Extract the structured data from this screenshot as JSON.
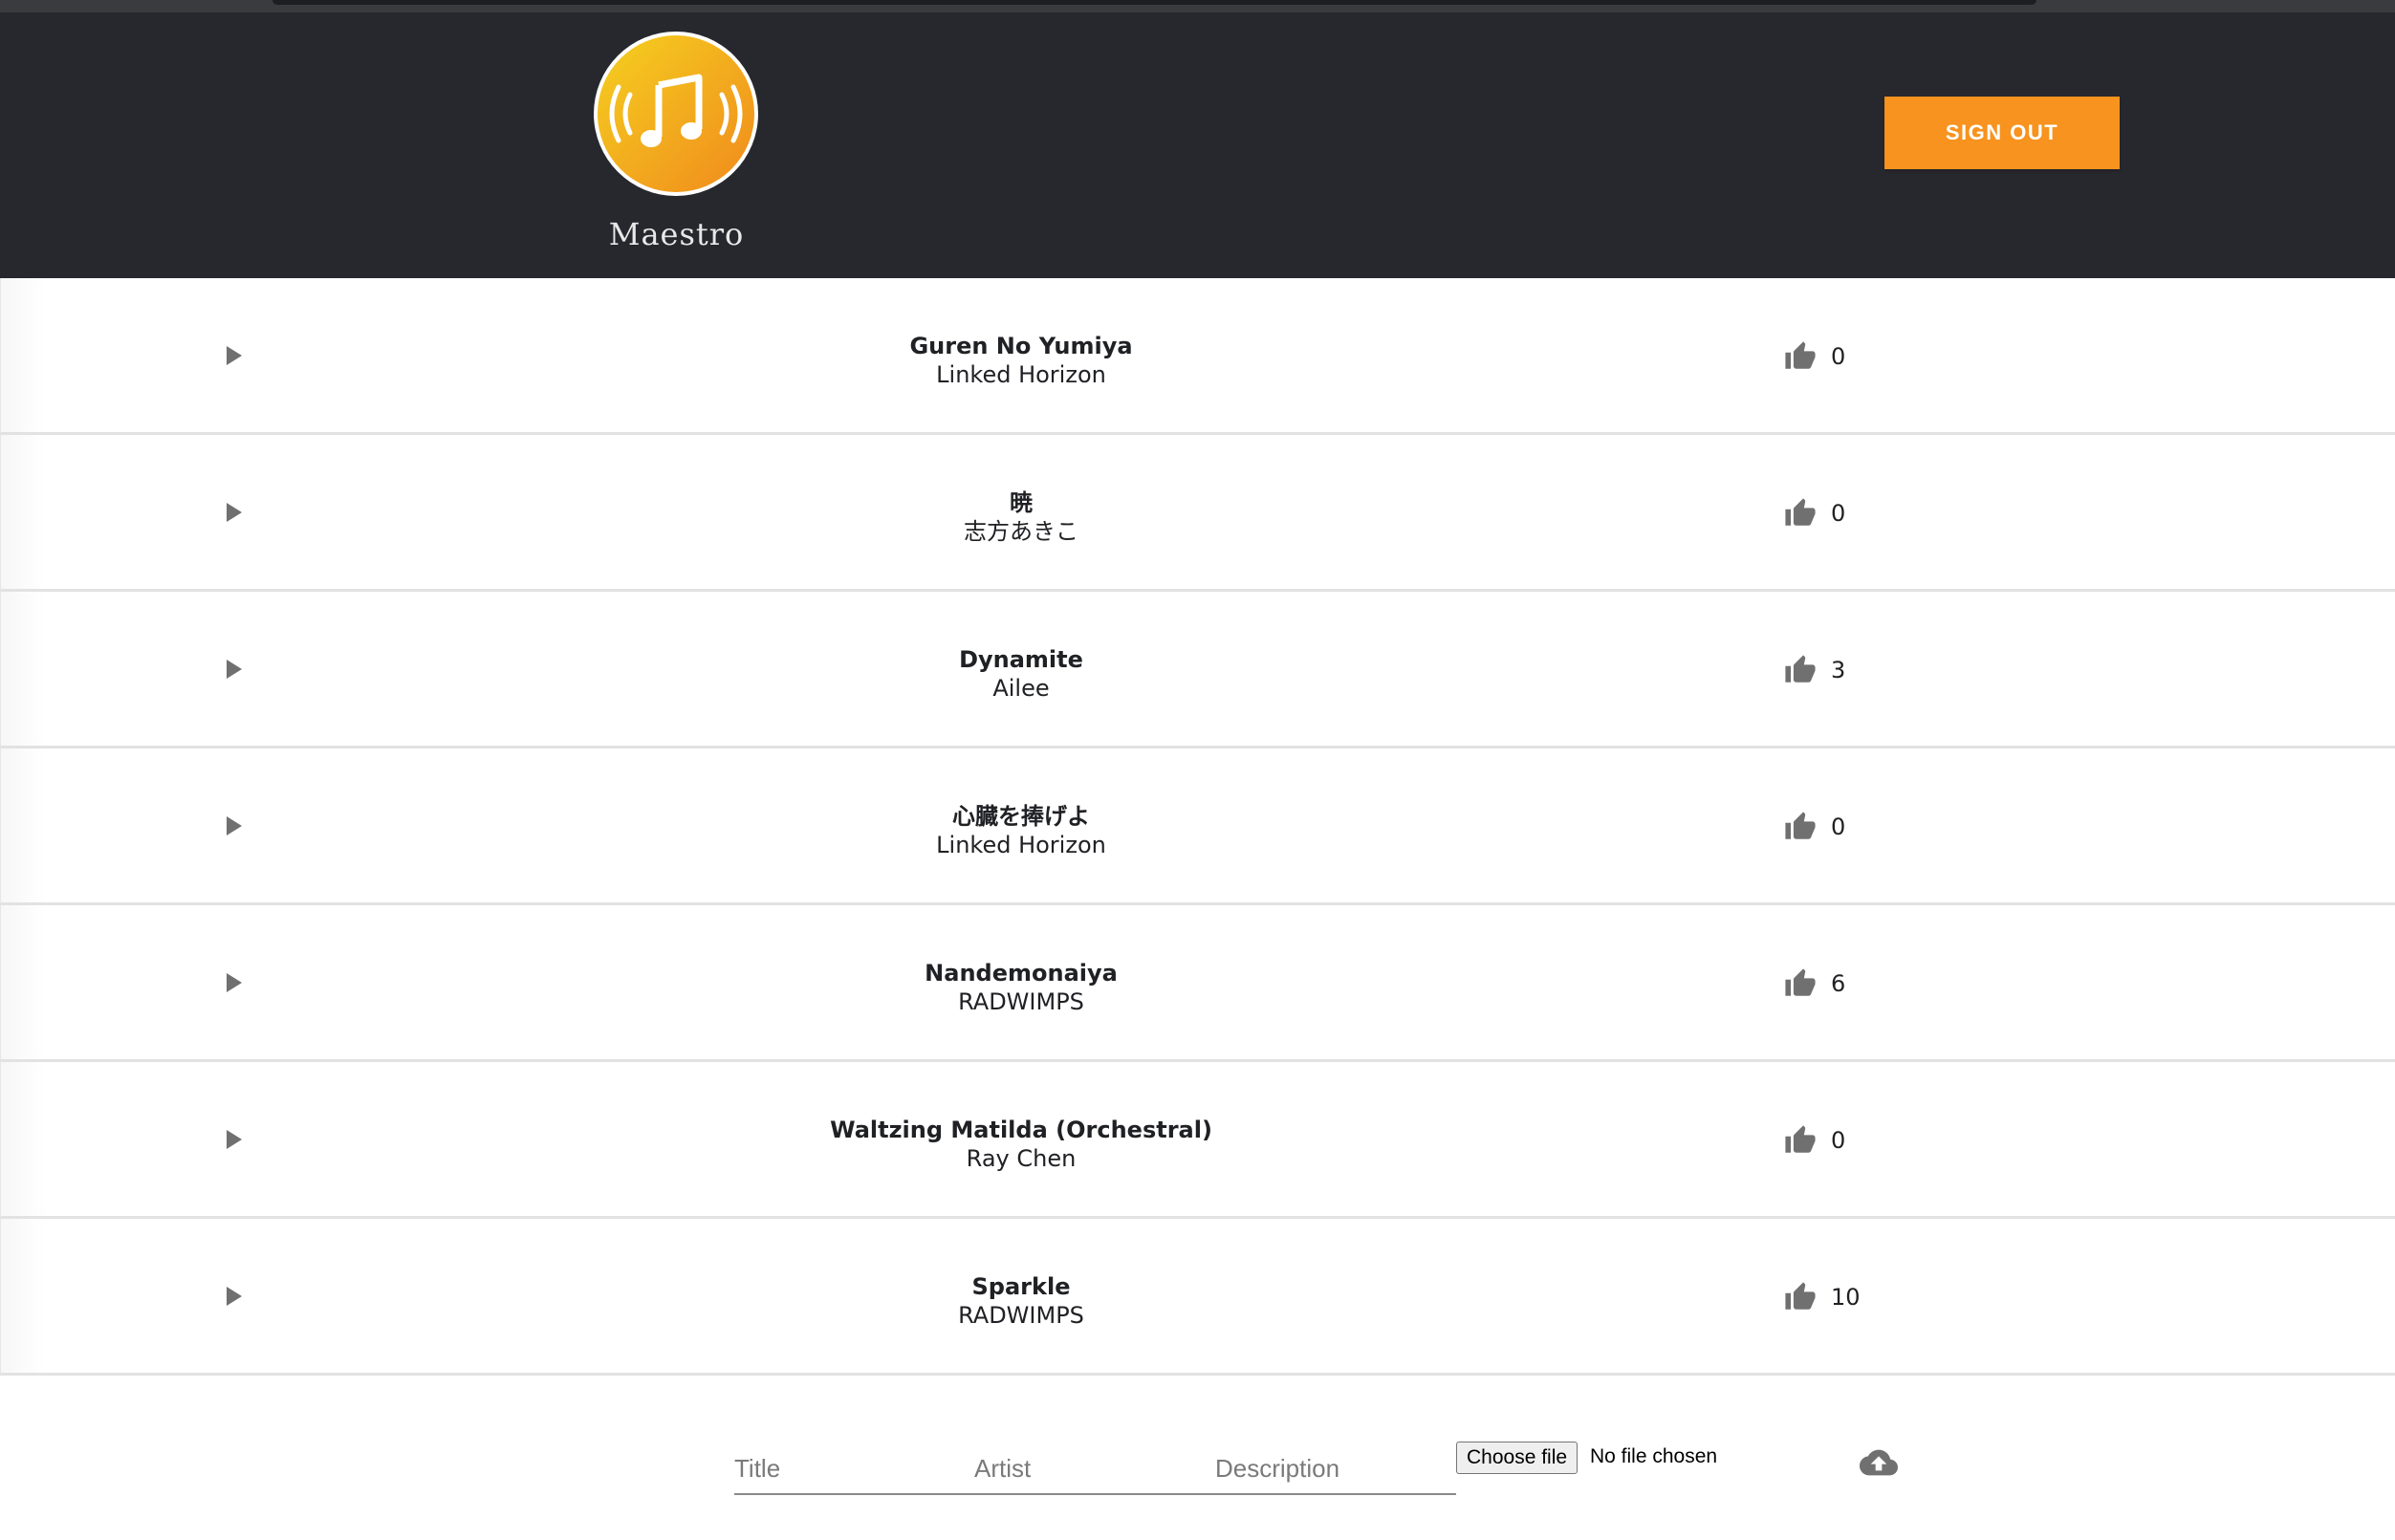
{
  "app": {
    "name": "Maestro"
  },
  "header": {
    "signout_label": "SIGN OUT"
  },
  "colors": {
    "navbar": "#27282d",
    "accent": "#f7931e",
    "icon": "#707070"
  },
  "songs": [
    {
      "title": "Guren No Yumiya",
      "artist": "Linked Horizon",
      "likes": "0"
    },
    {
      "title": "暁",
      "artist": "志方あきこ",
      "likes": "0"
    },
    {
      "title": "Dynamite",
      "artist": "Ailee",
      "likes": "3"
    },
    {
      "title": "心臓を捧げよ",
      "artist": "Linked Horizon",
      "likes": "0"
    },
    {
      "title": "Nandemonaiya",
      "artist": "RADWIMPS",
      "likes": "6"
    },
    {
      "title": "Waltzing Matilda (Orchestral)",
      "artist": "Ray Chen",
      "likes": "0"
    },
    {
      "title": "Sparkle",
      "artist": "RADWIMPS",
      "likes": "10"
    }
  ],
  "upload": {
    "title_placeholder": "Title",
    "artist_placeholder": "Artist",
    "description_placeholder": "Description",
    "choose_file_label": "Choose file",
    "file_status": "No file chosen"
  },
  "icons": {
    "play": "play-icon",
    "like": "thumbs-up-icon",
    "upload": "cloud-upload-icon",
    "logo": "music-note-icon"
  }
}
